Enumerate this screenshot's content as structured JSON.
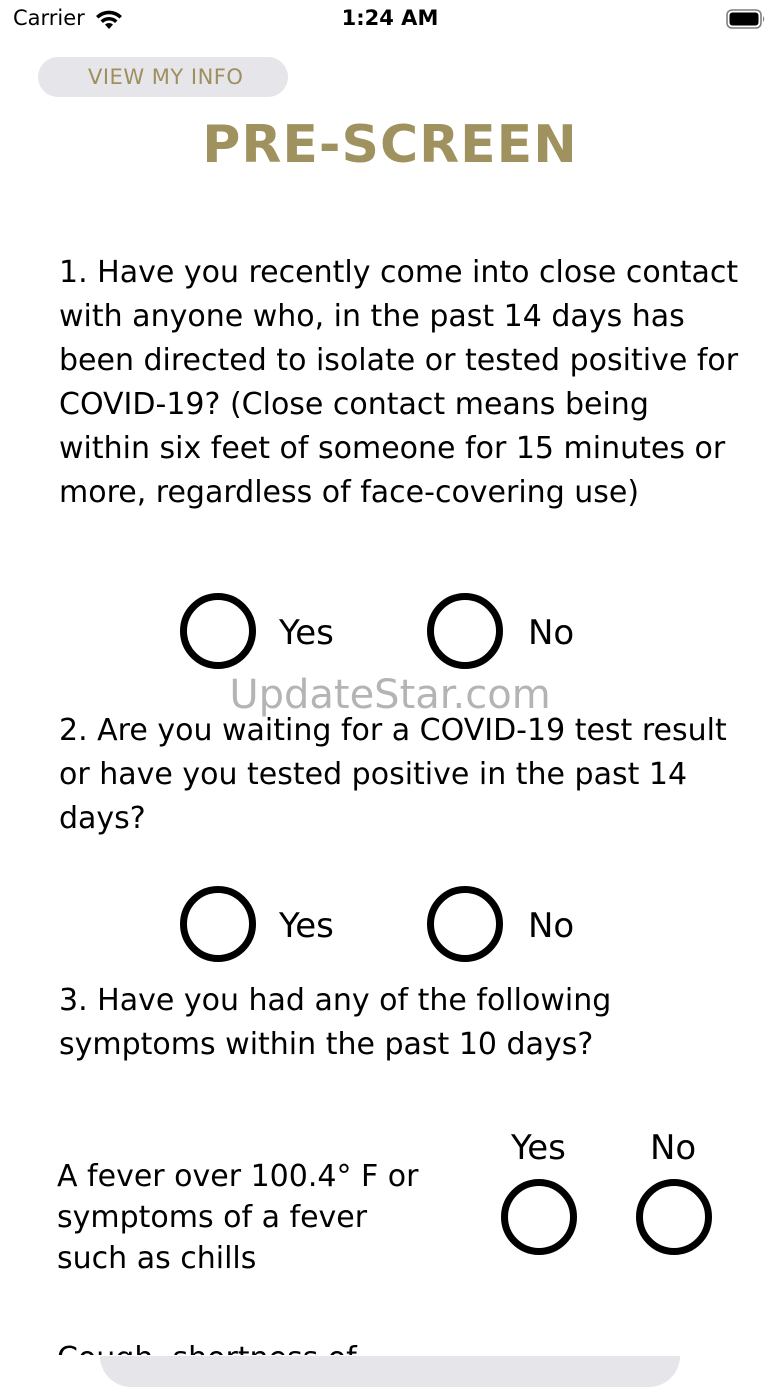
{
  "status_bar": {
    "carrier": "Carrier",
    "time": "1:24 AM",
    "wifi_icon": "wifi-icon",
    "battery_icon": "battery-icon"
  },
  "header": {
    "view_info_label": "VIEW MY INFO",
    "title": "PRE-SCREEN"
  },
  "colors": {
    "accent": "#a0925f",
    "button_bg": "#e5e5ea"
  },
  "watermark": "UpdateStar.com",
  "questions": [
    {
      "text": "1. Have you recently come into close contact with anyone who, in the past 14 days has been directed to isolate or tested positive for COVID-19? (Close contact means being within six feet of someone for 15 minutes or more, regardless of face-covering use)",
      "yes_label": "Yes",
      "no_label": "No"
    },
    {
      "text": "2. Are you waiting for a COVID-19 test result or have you tested positive in the past 14 days?",
      "yes_label": "Yes",
      "no_label": "No"
    },
    {
      "text": "3. Have you had any of the following symptoms within the past 10 days?"
    }
  ],
  "symptoms": {
    "yes_header": "Yes",
    "no_header": "No",
    "items": [
      {
        "text": "A fever over 100.4° F or symptoms of a fever such as chills"
      },
      {
        "text": "Cough, shortness of"
      }
    ]
  }
}
